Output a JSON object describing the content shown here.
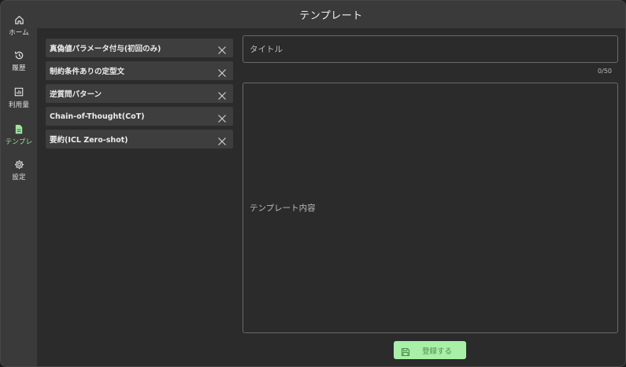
{
  "header": {
    "title": "テンプレート"
  },
  "sidebar": {
    "items": [
      {
        "label": "ホーム",
        "icon": "home-icon",
        "active": false
      },
      {
        "label": "履歴",
        "icon": "history-icon",
        "active": false
      },
      {
        "label": "利用量",
        "icon": "usage-chart-icon",
        "active": false
      },
      {
        "label": "テンプレ",
        "icon": "document-icon",
        "active": true
      },
      {
        "label": "設定",
        "icon": "gear-icon",
        "active": false
      }
    ],
    "active_color": "#9ee69e"
  },
  "templates": {
    "items": [
      {
        "name": "真偽値パラメータ付与(初回のみ)"
      },
      {
        "name": "制約条件ありの定型文"
      },
      {
        "name": "逆質問パターン"
      },
      {
        "name": "Chain-of-Thought(CoT)"
      },
      {
        "name": "要約(ICL Zero-shot)"
      }
    ]
  },
  "form": {
    "title_placeholder": "タイトル",
    "title_value": "",
    "counter": "0/50",
    "content_placeholder": "テンプレート内容",
    "content_value": "",
    "register_label": "登録する"
  },
  "colors": {
    "accent": "#a8f0a8",
    "accent_text": "#4e8a4e",
    "background": "#2b2b2b",
    "panel": "#3a3a3a"
  }
}
